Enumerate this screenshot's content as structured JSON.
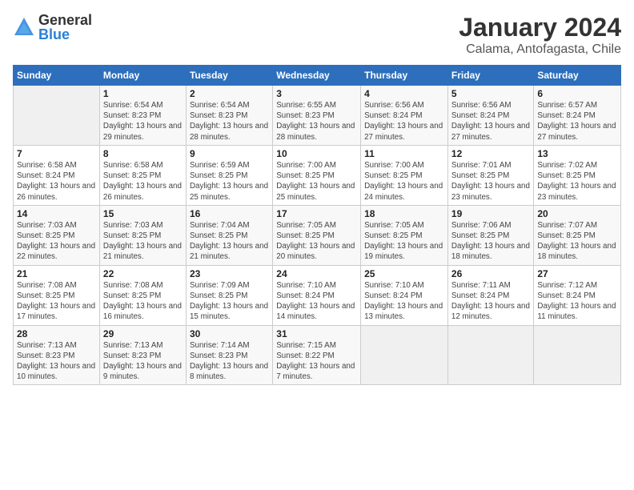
{
  "header": {
    "logo_general": "General",
    "logo_blue": "Blue",
    "month_year": "January 2024",
    "location": "Calama, Antofagasta, Chile"
  },
  "weekdays": [
    "Sunday",
    "Monday",
    "Tuesday",
    "Wednesday",
    "Thursday",
    "Friday",
    "Saturday"
  ],
  "weeks": [
    [
      {
        "day": "",
        "info": ""
      },
      {
        "day": "1",
        "info": "Sunrise: 6:54 AM\nSunset: 8:23 PM\nDaylight: 13 hours and 29 minutes."
      },
      {
        "day": "2",
        "info": "Sunrise: 6:54 AM\nSunset: 8:23 PM\nDaylight: 13 hours and 28 minutes."
      },
      {
        "day": "3",
        "info": "Sunrise: 6:55 AM\nSunset: 8:23 PM\nDaylight: 13 hours and 28 minutes."
      },
      {
        "day": "4",
        "info": "Sunrise: 6:56 AM\nSunset: 8:24 PM\nDaylight: 13 hours and 27 minutes."
      },
      {
        "day": "5",
        "info": "Sunrise: 6:56 AM\nSunset: 8:24 PM\nDaylight: 13 hours and 27 minutes."
      },
      {
        "day": "6",
        "info": "Sunrise: 6:57 AM\nSunset: 8:24 PM\nDaylight: 13 hours and 27 minutes."
      }
    ],
    [
      {
        "day": "7",
        "info": "Sunrise: 6:58 AM\nSunset: 8:24 PM\nDaylight: 13 hours and 26 minutes."
      },
      {
        "day": "8",
        "info": "Sunrise: 6:58 AM\nSunset: 8:25 PM\nDaylight: 13 hours and 26 minutes."
      },
      {
        "day": "9",
        "info": "Sunrise: 6:59 AM\nSunset: 8:25 PM\nDaylight: 13 hours and 25 minutes."
      },
      {
        "day": "10",
        "info": "Sunrise: 7:00 AM\nSunset: 8:25 PM\nDaylight: 13 hours and 25 minutes."
      },
      {
        "day": "11",
        "info": "Sunrise: 7:00 AM\nSunset: 8:25 PM\nDaylight: 13 hours and 24 minutes."
      },
      {
        "day": "12",
        "info": "Sunrise: 7:01 AM\nSunset: 8:25 PM\nDaylight: 13 hours and 23 minutes."
      },
      {
        "day": "13",
        "info": "Sunrise: 7:02 AM\nSunset: 8:25 PM\nDaylight: 13 hours and 23 minutes."
      }
    ],
    [
      {
        "day": "14",
        "info": "Sunrise: 7:03 AM\nSunset: 8:25 PM\nDaylight: 13 hours and 22 minutes."
      },
      {
        "day": "15",
        "info": "Sunrise: 7:03 AM\nSunset: 8:25 PM\nDaylight: 13 hours and 21 minutes."
      },
      {
        "day": "16",
        "info": "Sunrise: 7:04 AM\nSunset: 8:25 PM\nDaylight: 13 hours and 21 minutes."
      },
      {
        "day": "17",
        "info": "Sunrise: 7:05 AM\nSunset: 8:25 PM\nDaylight: 13 hours and 20 minutes."
      },
      {
        "day": "18",
        "info": "Sunrise: 7:05 AM\nSunset: 8:25 PM\nDaylight: 13 hours and 19 minutes."
      },
      {
        "day": "19",
        "info": "Sunrise: 7:06 AM\nSunset: 8:25 PM\nDaylight: 13 hours and 18 minutes."
      },
      {
        "day": "20",
        "info": "Sunrise: 7:07 AM\nSunset: 8:25 PM\nDaylight: 13 hours and 18 minutes."
      }
    ],
    [
      {
        "day": "21",
        "info": "Sunrise: 7:08 AM\nSunset: 8:25 PM\nDaylight: 13 hours and 17 minutes."
      },
      {
        "day": "22",
        "info": "Sunrise: 7:08 AM\nSunset: 8:25 PM\nDaylight: 13 hours and 16 minutes."
      },
      {
        "day": "23",
        "info": "Sunrise: 7:09 AM\nSunset: 8:25 PM\nDaylight: 13 hours and 15 minutes."
      },
      {
        "day": "24",
        "info": "Sunrise: 7:10 AM\nSunset: 8:24 PM\nDaylight: 13 hours and 14 minutes."
      },
      {
        "day": "25",
        "info": "Sunrise: 7:10 AM\nSunset: 8:24 PM\nDaylight: 13 hours and 13 minutes."
      },
      {
        "day": "26",
        "info": "Sunrise: 7:11 AM\nSunset: 8:24 PM\nDaylight: 13 hours and 12 minutes."
      },
      {
        "day": "27",
        "info": "Sunrise: 7:12 AM\nSunset: 8:24 PM\nDaylight: 13 hours and 11 minutes."
      }
    ],
    [
      {
        "day": "28",
        "info": "Sunrise: 7:13 AM\nSunset: 8:23 PM\nDaylight: 13 hours and 10 minutes."
      },
      {
        "day": "29",
        "info": "Sunrise: 7:13 AM\nSunset: 8:23 PM\nDaylight: 13 hours and 9 minutes."
      },
      {
        "day": "30",
        "info": "Sunrise: 7:14 AM\nSunset: 8:23 PM\nDaylight: 13 hours and 8 minutes."
      },
      {
        "day": "31",
        "info": "Sunrise: 7:15 AM\nSunset: 8:22 PM\nDaylight: 13 hours and 7 minutes."
      },
      {
        "day": "",
        "info": ""
      },
      {
        "day": "",
        "info": ""
      },
      {
        "day": "",
        "info": ""
      }
    ]
  ]
}
